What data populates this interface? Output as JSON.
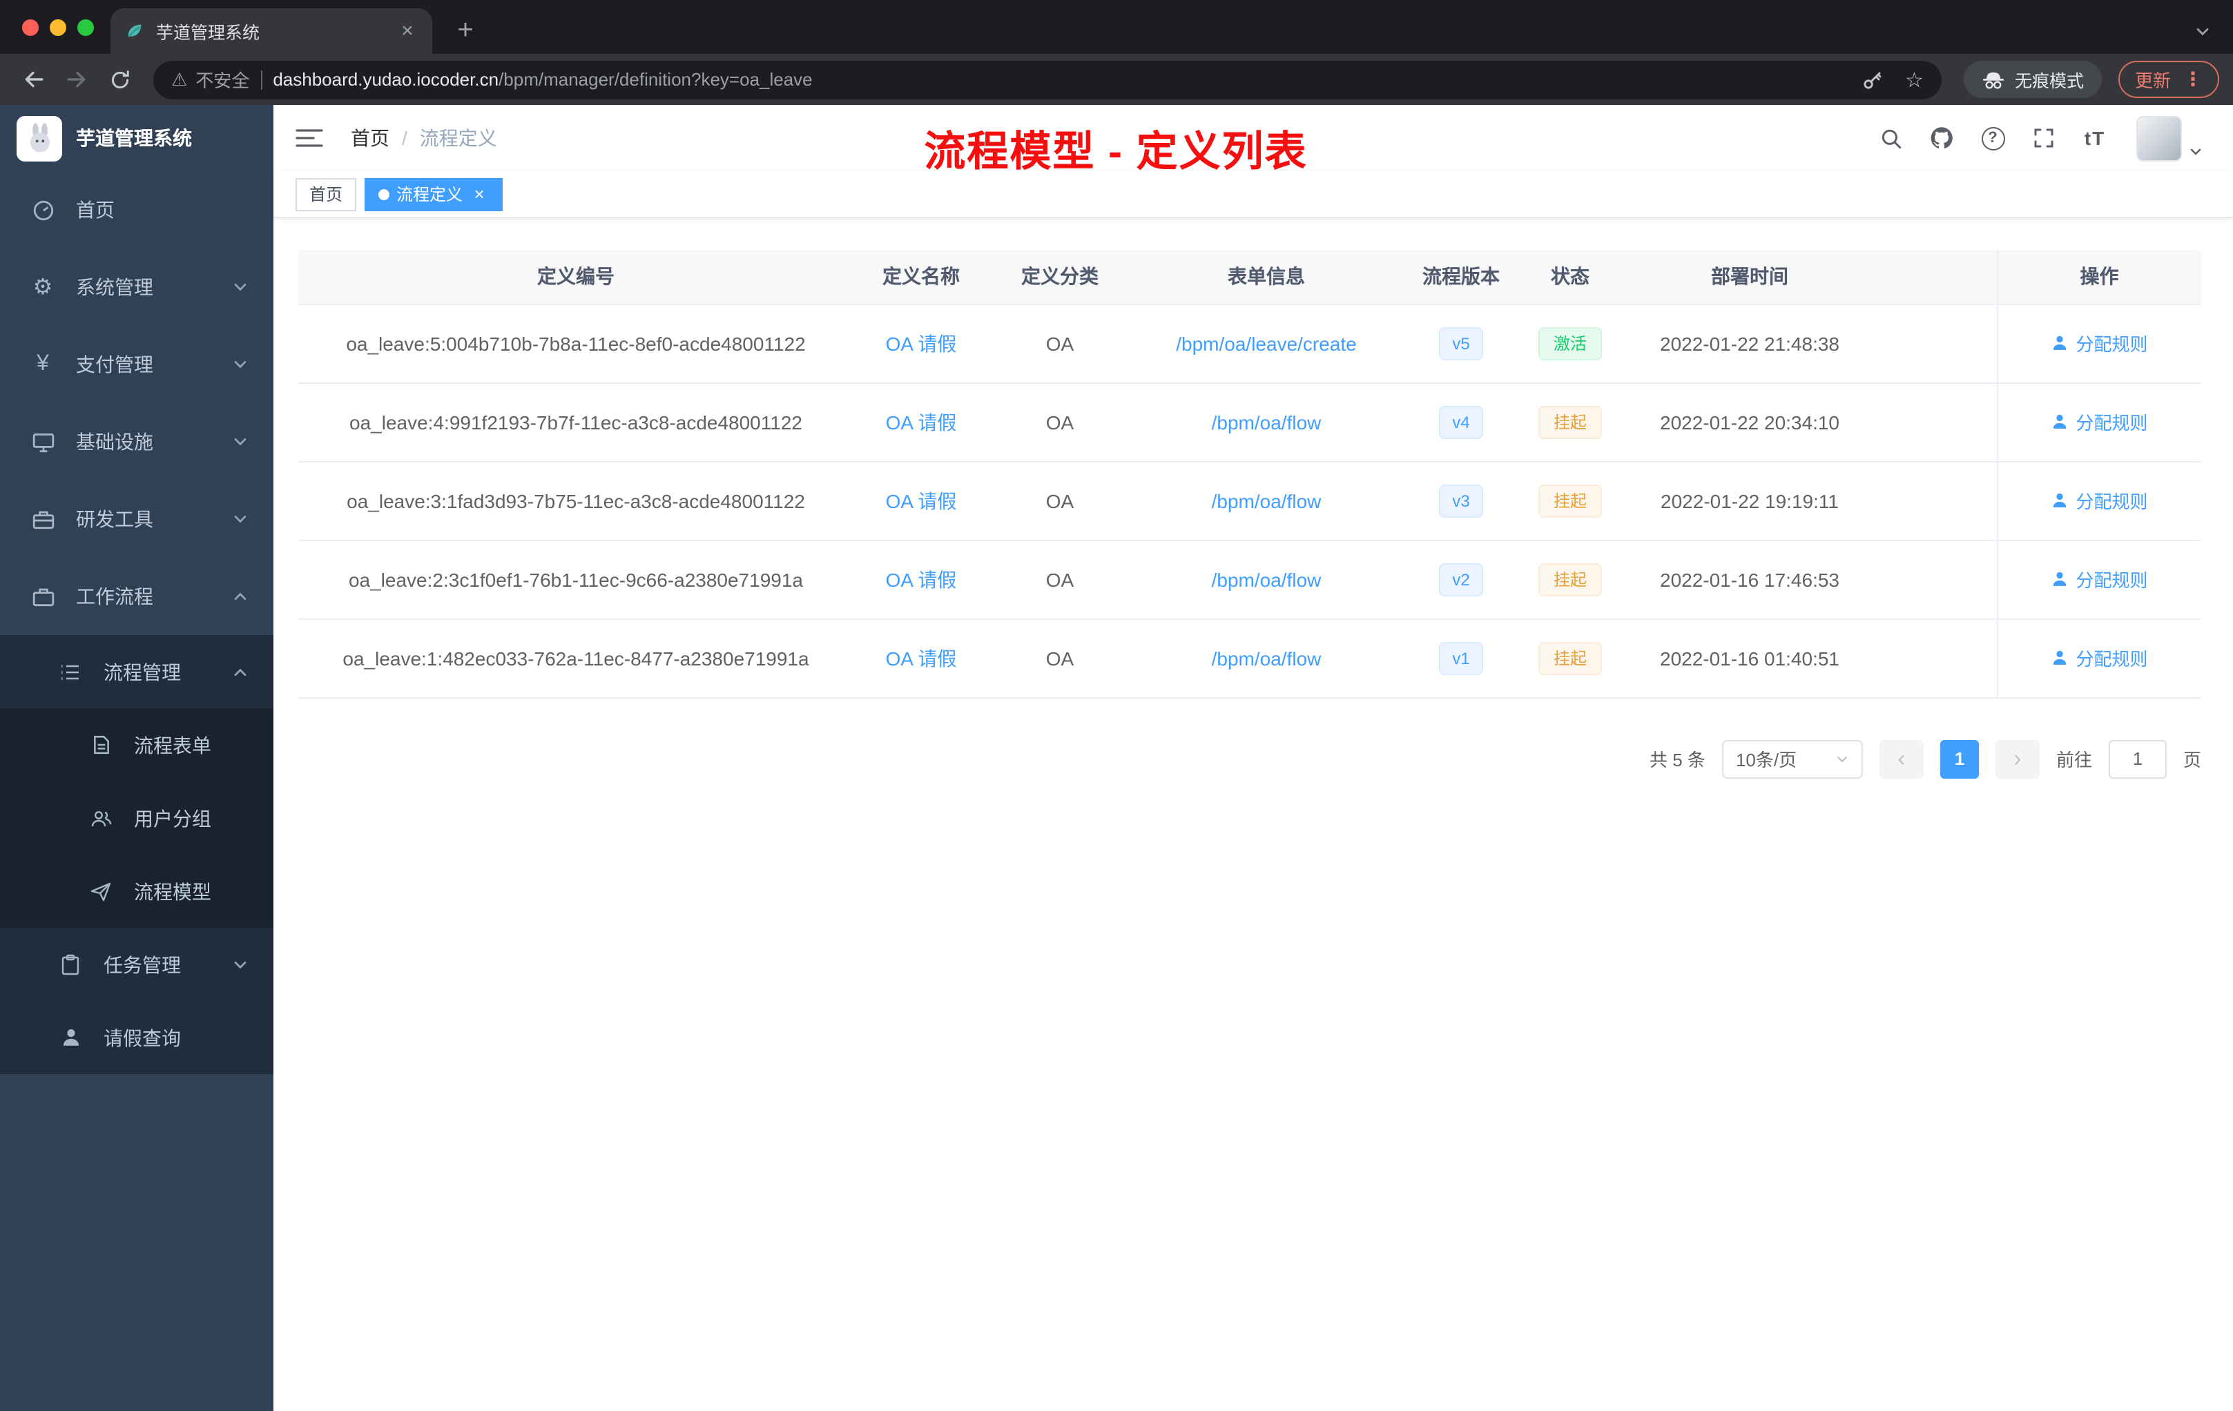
{
  "browser": {
    "tab_title": "芋道管理系统",
    "security_label": "不安全",
    "url_domain": "dashboard.yudao.iocoder.cn",
    "url_path": "/bpm/manager/definition?key=oa_leave",
    "incognito_label": "无痕模式",
    "update_label": "更新"
  },
  "icons": {
    "warning": "⚠",
    "star": "☆",
    "dots": "⋮",
    "gear": "⚙",
    "yen": "¥",
    "plus": "+",
    "close": "×",
    "question": "?",
    "font_size": "tT",
    "prev": "‹",
    "next": "›"
  },
  "sidebar": {
    "app_title": "芋道管理系统",
    "items": [
      {
        "label": "首页"
      },
      {
        "label": "系统管理"
      },
      {
        "label": "支付管理"
      },
      {
        "label": "基础设施"
      },
      {
        "label": "研发工具"
      },
      {
        "label": "工作流程"
      }
    ],
    "submenu": {
      "process_group": {
        "label": "流程管理",
        "children": [
          {
            "label": "流程表单"
          },
          {
            "label": "用户分组"
          },
          {
            "label": "流程模型"
          }
        ]
      },
      "task": {
        "label": "任务管理"
      },
      "leave": {
        "label": "请假查询"
      }
    }
  },
  "header": {
    "breadcrumb_home": "首页",
    "breadcrumb_sep": "/",
    "breadcrumb_current": "流程定义",
    "annotation": "流程模型 - 定义列表"
  },
  "tags": {
    "home": "首页",
    "current": "流程定义"
  },
  "table": {
    "columns": [
      "定义编号",
      "定义名称",
      "定义分类",
      "表单信息",
      "流程版本",
      "状态",
      "部署时间",
      "操作"
    ],
    "rows": [
      {
        "id": "oa_leave:5:004b710b-7b8a-11ec-8ef0-acde48001122",
        "name": "OA 请假",
        "category": "OA",
        "form": "/bpm/oa/leave/create",
        "version": "v5",
        "status": "激活",
        "time": "2022-01-22 21:48:38",
        "action": "分配规则"
      },
      {
        "id": "oa_leave:4:991f2193-7b7f-11ec-a3c8-acde48001122",
        "name": "OA 请假",
        "category": "OA",
        "form": "/bpm/oa/flow",
        "version": "v4",
        "status": "挂起",
        "time": "2022-01-22 20:34:10",
        "action": "分配规则"
      },
      {
        "id": "oa_leave:3:1fad3d93-7b75-11ec-a3c8-acde48001122",
        "name": "OA 请假",
        "category": "OA",
        "form": "/bpm/oa/flow",
        "version": "v3",
        "status": "挂起",
        "time": "2022-01-22 19:19:11",
        "action": "分配规则"
      },
      {
        "id": "oa_leave:2:3c1f0ef1-76b1-11ec-9c66-a2380e71991a",
        "name": "OA 请假",
        "category": "OA",
        "form": "/bpm/oa/flow",
        "version": "v2",
        "status": "挂起",
        "time": "2022-01-16 17:46:53",
        "action": "分配规则"
      },
      {
        "id": "oa_leave:1:482ec033-762a-11ec-8477-a2380e71991a",
        "name": "OA 请假",
        "category": "OA",
        "form": "/bpm/oa/flow",
        "version": "v1",
        "status": "挂起",
        "time": "2022-01-16 01:40:51",
        "action": "分配规则"
      }
    ]
  },
  "pagination": {
    "total": "共 5 条",
    "page_size": "10条/页",
    "page": "1",
    "goto_label": "前往",
    "goto_value": "1",
    "goto_suffix": "页"
  },
  "colors": {
    "accent": "#409eff",
    "success": "#13ce66",
    "warning": "#e6a23c",
    "annotation_red": "#f50f0f",
    "sidebar_bg": "#304156",
    "submenu_bg": "#1f2d3d"
  }
}
